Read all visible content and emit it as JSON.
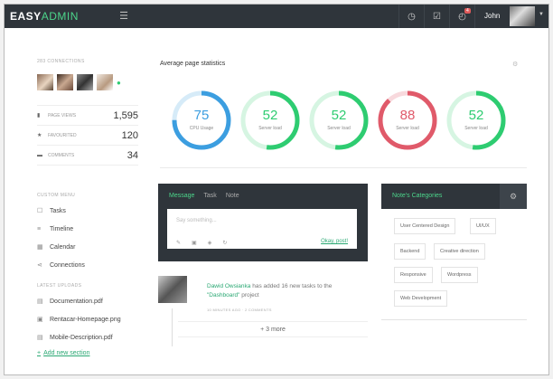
{
  "topbar": {
    "logo_a": "EASY",
    "logo_b": "ADMIN",
    "menu_icon": "hamburger-icon",
    "notification_count": "4",
    "user_name": "John"
  },
  "sidebar": {
    "connections_title": "283 CONNECTIONS",
    "stats": [
      {
        "label": "PAGE VIEWS",
        "value": "1,595",
        "icon": "chart-icon"
      },
      {
        "label": "FAVOURITED",
        "value": "120",
        "icon": "star-icon"
      },
      {
        "label": "COMMENTS",
        "value": "34",
        "icon": "comment-icon"
      }
    ],
    "menu_title": "CUSTOM MENU",
    "menu": [
      {
        "label": "Tasks",
        "icon": "checkbox-icon"
      },
      {
        "label": "Timeline",
        "icon": "list-icon"
      },
      {
        "label": "Calendar",
        "icon": "calendar-icon"
      },
      {
        "label": "Connections",
        "icon": "share-icon"
      }
    ],
    "uploads_title": "LATEST UPLOADS",
    "uploads": [
      {
        "label": "Documentation.pdf",
        "icon": "file-icon"
      },
      {
        "label": "Rentacar-Homepage.png",
        "icon": "image-icon"
      },
      {
        "label": "Mobile-Description.pdf",
        "icon": "file-icon"
      }
    ],
    "add_section": "Add new section"
  },
  "main": {
    "title": "Average page statistics",
    "gauges": [
      {
        "value": "75",
        "label": "CPU Usage",
        "pct": 0.75,
        "color": "#3c9ee0",
        "track": "#d6ebf8"
      },
      {
        "value": "52",
        "label": "Server load",
        "pct": 0.52,
        "color": "#2ecc71",
        "track": "#d6f5e2"
      },
      {
        "value": "52",
        "label": "Server load",
        "pct": 0.52,
        "color": "#2ecc71",
        "track": "#d6f5e2"
      },
      {
        "value": "88",
        "label": "Server load",
        "pct": 0.88,
        "color": "#e05a6a",
        "track": "#f8d9dd"
      },
      {
        "value": "52",
        "label": "Server load",
        "pct": 0.52,
        "color": "#2ecc71",
        "track": "#d6f5e2"
      }
    ]
  },
  "message": {
    "tabs": [
      "Message",
      "Task",
      "Note"
    ],
    "placeholder": "Say something...",
    "post": "Okay, post!"
  },
  "feed": {
    "user": "Dawid Owsianka",
    "text_mid": " has added 16 new tasks to the ",
    "project": "\"Dashboard\"",
    "text_end": " project",
    "meta": "10 MINUTES AGO · 2 COMMENTS",
    "more": "+ 3 more"
  },
  "notes": {
    "title": "Note's Categories",
    "tags": [
      "User Centered Design",
      "UI/UX",
      "Backend",
      "Creative direction",
      "Responsive",
      "Wordpress",
      "Web Development"
    ]
  },
  "colors": {
    "accent": "#2ecc71",
    "dark": "#2f353b",
    "danger": "#e05a6a",
    "blue": "#3c9ee0"
  }
}
